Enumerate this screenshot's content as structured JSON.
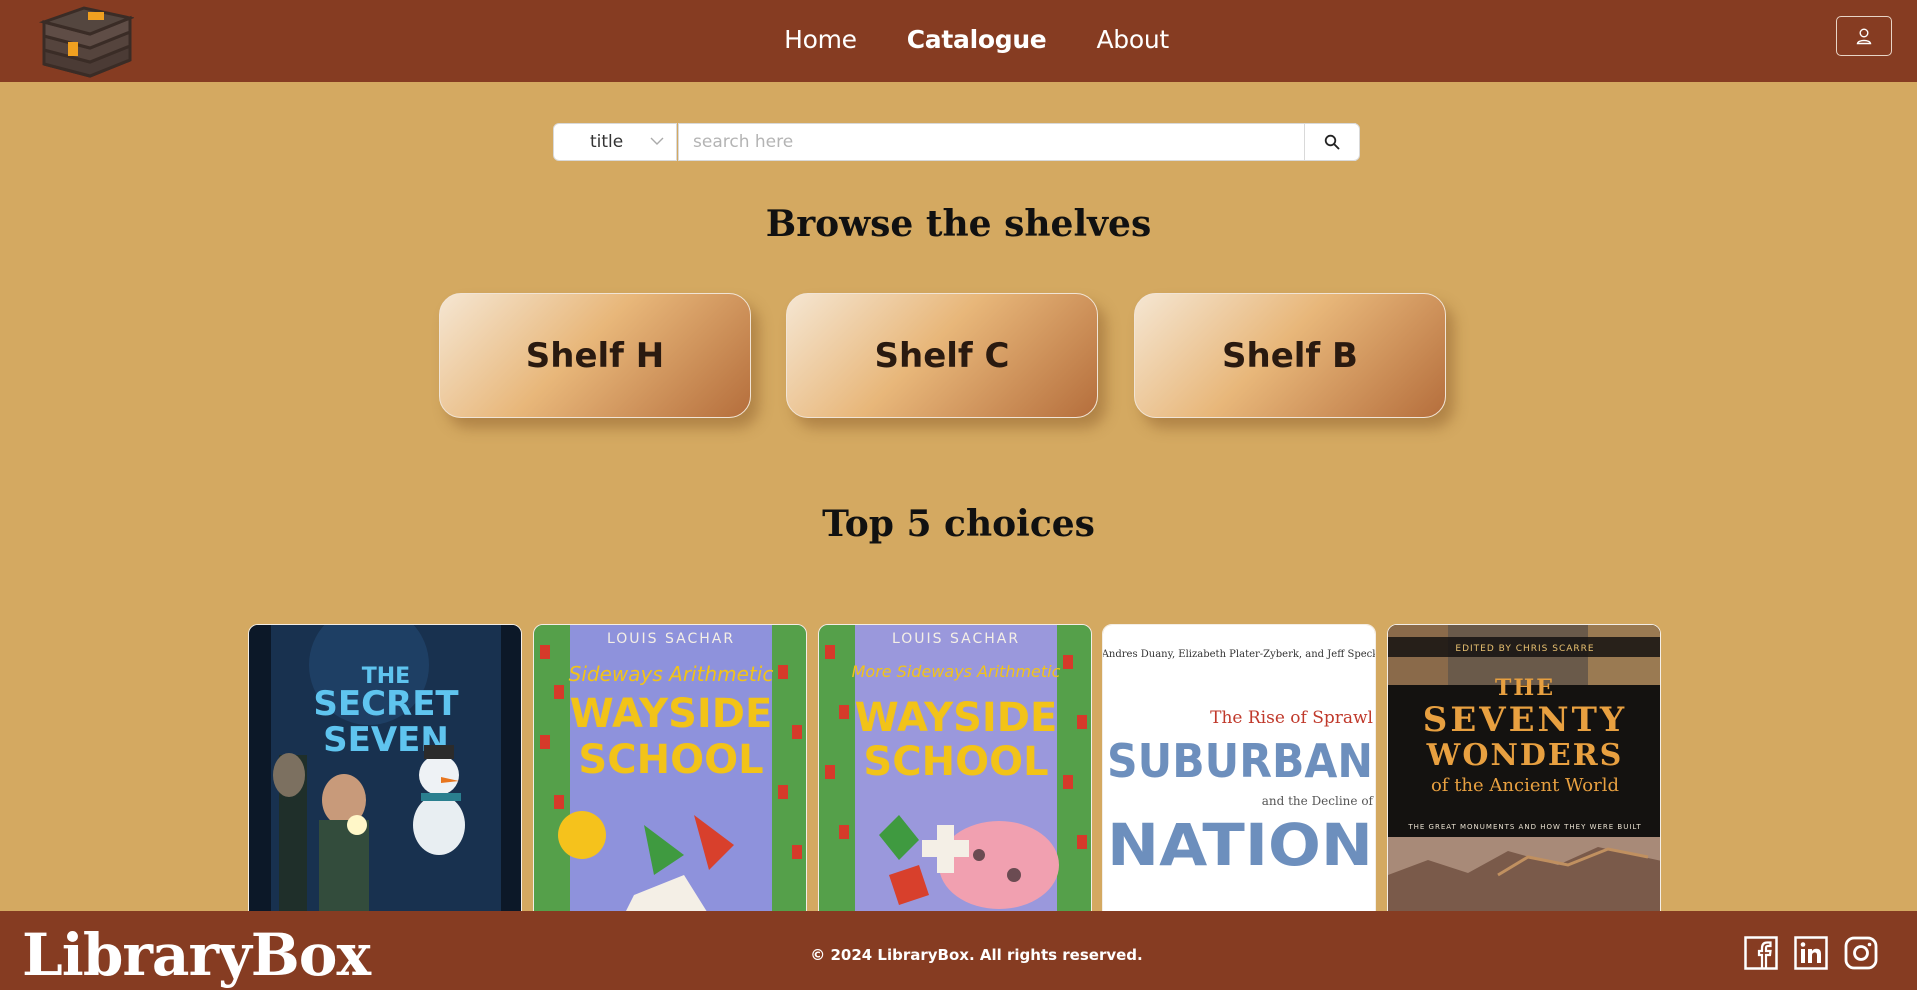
{
  "nav": {
    "links": [
      {
        "label": "Home",
        "active": false
      },
      {
        "label": "Catalogue",
        "active": true
      },
      {
        "label": "About",
        "active": false
      }
    ],
    "user_icon": "user-icon"
  },
  "search": {
    "field_selected": "title",
    "placeholder": "search here",
    "button_icon": "search-icon"
  },
  "browse": {
    "heading": "Browse the shelves",
    "shelves": [
      "Shelf H",
      "Shelf C",
      "Shelf B"
    ]
  },
  "top": {
    "heading": "Top 5 choices",
    "books": [
      {
        "cover_text": "THE SECRET SEVEN",
        "cover_color": "#1d3a5e"
      },
      {
        "cover_text": "Sideways Arithmetic from Wayside School",
        "author": "LOUIS SACHAR",
        "cover_color": "#8c8fd8"
      },
      {
        "cover_text": "More Sideways Arithmetic from Wayside School",
        "author": "LOUIS SACHAR",
        "cover_color": "#8c8fd8"
      },
      {
        "cover_text": "SUBURBAN NATION",
        "subtitle": "The Rise of Sprawl and the Decline of",
        "authors": "Andres Duany, Elizabeth Plater-Zyberk, and Jeff Speck",
        "cover_color": "#ffffff"
      },
      {
        "cover_text": "THE SEVENTY WONDERS of the Ancient World",
        "subtitle": "THE GREAT MONUMENTS AND HOW THEY WERE BUILT",
        "editor": "EDITED BY CHRIS SCARRE",
        "cover_color": "#111111"
      }
    ]
  },
  "footer": {
    "brand": "LibraryBox",
    "copyright": "© 2024 LibraryBox. All rights reserved.",
    "social": [
      "facebook-icon",
      "linkedin-icon",
      "instagram-icon"
    ]
  },
  "colors": {
    "header_bg": "#863c22",
    "page_bg": "#d4a961"
  }
}
